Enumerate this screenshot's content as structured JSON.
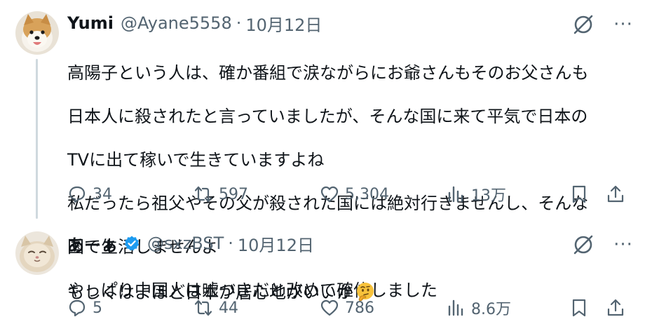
{
  "tweets": [
    {
      "name": "Yumi",
      "handle": "@Ayane5558",
      "separator": "·",
      "date": "10月12日",
      "verified": false,
      "text_lines": [
        "高陽子という人は、確か番組で涙ながらにお爺さんもそのお父さんも",
        "日本人に殺されたと言っていましたが、そんな国に来て平気で日本の",
        "TVに出て稼いで生きていますよね",
        "私だったら祖父やその父が殺された国には絶対行きませんし、そんな",
        "国で生活しませんよ",
        "やっぱり中国人は嘘つきだと改めて確信しました"
      ],
      "replies": "34",
      "reposts": "597",
      "likes": "5,304",
      "views": "13万"
    },
    {
      "name": "あーぁ",
      "handle": "@sxzBST",
      "separator": "·",
      "date": "10月12日",
      "verified": true,
      "text": "もしくはよほど日本が居心地がいいか",
      "emoji": "thinking-face-emoji",
      "replies": "5",
      "reposts": "44",
      "likes": "786",
      "views": "8.6万"
    }
  ],
  "icons": {
    "reply": "reply-icon",
    "repost": "repost-icon",
    "like": "like-icon",
    "views": "views-icon",
    "bookmark": "bookmark-icon",
    "share": "share-icon",
    "grok": "grok-icon",
    "more": "more-icon"
  },
  "colors": {
    "text": "#0f1419",
    "secondary": "#536471",
    "thread_line": "#cfd9de",
    "verified": "#1d9bf0"
  },
  "more_glyph": "···"
}
